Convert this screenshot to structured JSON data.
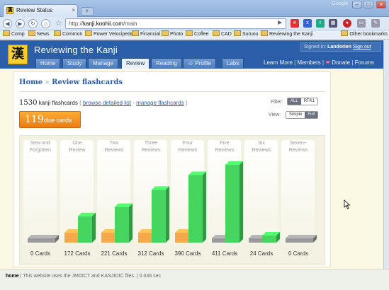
{
  "browser": {
    "tab_title": "Review Status",
    "tab_favicon": "漢",
    "tab_close": "×",
    "new_tab": "+",
    "profile_label": "Google",
    "url_prefix": "http://",
    "url_host": "kanji.koohii.com",
    "url_path": "/main",
    "buttons": {
      "back": "◀",
      "forward": "▶",
      "reload": "↻",
      "home": "⌂",
      "star": "☆",
      "go": "▶",
      "minimize": "–",
      "maximize": "□",
      "close": "×"
    },
    "extensions": [
      "e",
      "x",
      "t",
      "▦",
      "●",
      "▭",
      "✎"
    ],
    "bookmarks": [
      "Comp",
      "News",
      "Common",
      "Power Velocipede",
      "Financial",
      "Photo",
      "Coffee",
      "CAD",
      "Suruou",
      "Reviewing the Kanji"
    ],
    "other_bookmarks": "Other bookmarks",
    "icons": {
      "back": "back-arrow-icon",
      "forward": "forward-arrow-icon",
      "reload": "reload-icon",
      "home": "home-icon",
      "star": "star-icon",
      "folder": "folder-icon"
    }
  },
  "site": {
    "logo": "漢",
    "title": "Reviewing the Kanji",
    "nav": [
      "Home",
      "Study",
      "Manage",
      "Review",
      "Reading",
      "Profile",
      "Labs"
    ],
    "active_nav": "Review",
    "signed_in_label": "Signed in:",
    "username": "Landorien",
    "sign_out": "Sign out",
    "header_links": {
      "learn_more": "Learn More",
      "members": "Members",
      "donate": "Donate",
      "forums": "Forums",
      "sep": "|"
    },
    "colors": {
      "header_blue": "#2a5ea8",
      "logo_yellow": "#f6cf2b",
      "due_orange": "#f08a1c",
      "bar_green": "#46d660",
      "bar_orange": "#f7a94a",
      "bar_gray": "#9a9a9a"
    }
  },
  "page": {
    "breadcrumb_home": "Home",
    "breadcrumb_sep": "»",
    "breadcrumb_current": "Review flashcards",
    "total_count": "1530",
    "total_label": "kanji flashcards",
    "paren_open": "(",
    "paren_close": ")",
    "browse_link": "browse detailed list",
    "link_sep": "-",
    "manage_link": "manage flashcards",
    "filter_label": "Filter:",
    "filter_options": [
      "ALL",
      "RTK1"
    ],
    "filter_selected": "ALL",
    "view_label": "View:",
    "view_options": [
      "Simple",
      "Full"
    ],
    "view_selected": "Full",
    "due_count": "119",
    "due_label": "due cards"
  },
  "chart_data": {
    "type": "bar",
    "categories": [
      [
        "New and",
        "Forgotten"
      ],
      [
        "One",
        "Review"
      ],
      [
        "Two",
        "Reviews"
      ],
      [
        "Three",
        "Reviews"
      ],
      [
        "Four",
        "Reviews"
      ],
      [
        "Five",
        "Reviews"
      ],
      [
        "Six",
        "Reviews"
      ],
      [
        "Seven+",
        "Reviews"
      ]
    ],
    "series": [
      {
        "values": [
          0,
          33,
          33,
          33,
          33,
          0,
          0,
          0
        ]
      },
      {
        "values": [
          0,
          139,
          188,
          279,
          357,
          411,
          24,
          0
        ]
      }
    ],
    "totals": [
      "0 Cards",
      "172 Cards",
      "221 Cards",
      "312 Cards",
      "390 Cards",
      "411 Cards",
      "24 Cards",
      "0 Cards"
    ],
    "ylim": [
      0,
      411
    ],
    "grid": false
  },
  "footer": {
    "home": "home",
    "sep": "|",
    "text": "This website uses the JMDICT and KANJIDIC files.",
    "time": "0.046 sec"
  }
}
